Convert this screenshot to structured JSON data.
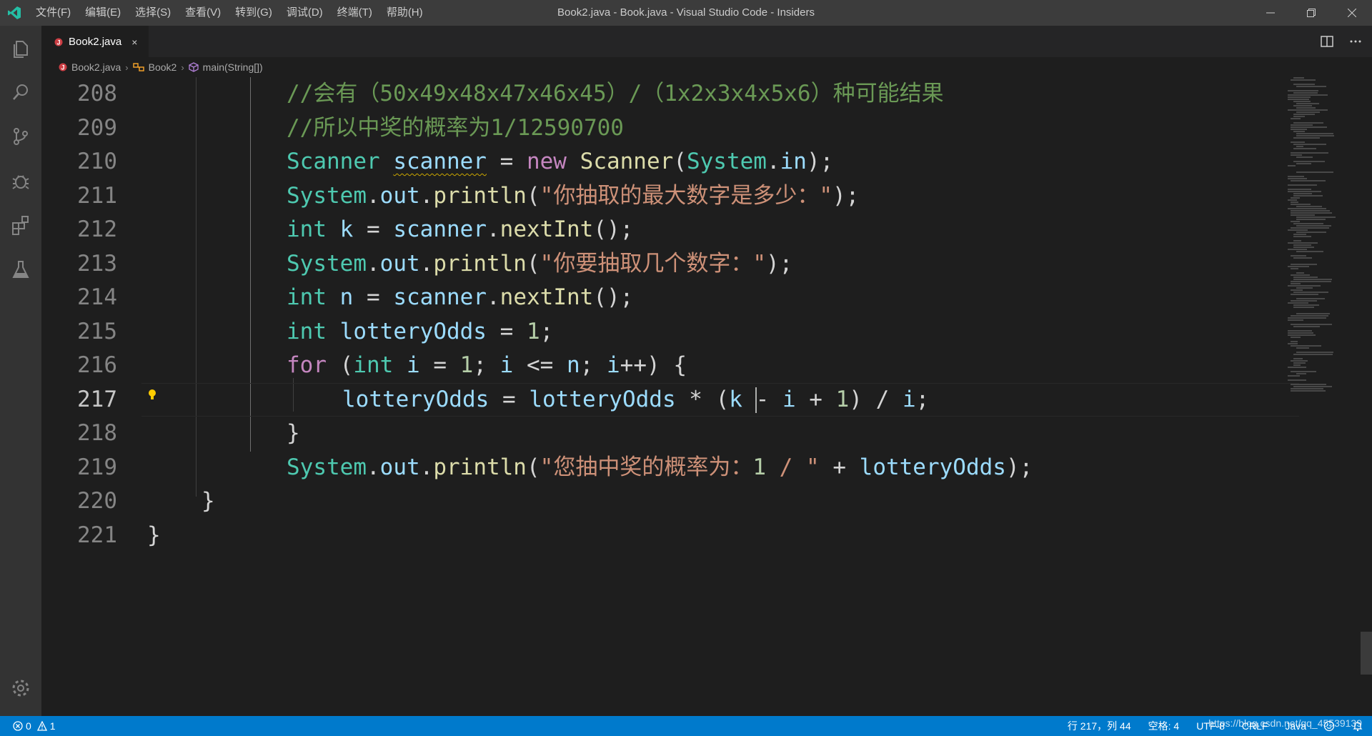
{
  "window": {
    "title": "Book2.java - Book.java - Visual Studio Code - Insiders",
    "menu": [
      "文件(F)",
      "编辑(E)",
      "选择(S)",
      "查看(V)",
      "转到(G)",
      "调试(D)",
      "终端(T)",
      "帮助(H)"
    ]
  },
  "activity_bar": [
    "explorer-icon",
    "search-icon",
    "source-control-icon",
    "debug-icon",
    "extensions-icon",
    "testing-icon",
    "settings-gear-icon"
  ],
  "tab": {
    "label": "Book2.java",
    "close": "×"
  },
  "breadcrumb": {
    "file": "Book2.java",
    "class": "Book2",
    "method": "main(String[])"
  },
  "editor": {
    "active_line": "217",
    "lines": [
      {
        "n": "208",
        "code": "//会有（50x49x48x47x46x45）/（1x2x3x4x5x6）种可能结果"
      },
      {
        "n": "209",
        "code": "//所以中奖的概率为1/12590700"
      },
      {
        "n": "210",
        "code": "Scanner scanner = new Scanner(System.in);"
      },
      {
        "n": "211",
        "code": "System.out.println(\"你抽取的最大数字是多少：\");"
      },
      {
        "n": "212",
        "code": "int k = scanner.nextInt();"
      },
      {
        "n": "213",
        "code": "System.out.println(\"你要抽取几个数字：\");"
      },
      {
        "n": "214",
        "code": "int n = scanner.nextInt();"
      },
      {
        "n": "215",
        "code": "int lotteryOdds = 1;"
      },
      {
        "n": "216",
        "code": "for (int i = 1; i <= n; i++) {"
      },
      {
        "n": "217",
        "code": "lotteryOdds = lotteryOdds * (k - i + 1) / i;"
      },
      {
        "n": "218",
        "code": "}"
      },
      {
        "n": "219",
        "code": "System.out.println(\"您抽中奖的概率为：1 / \" + lotteryOdds);"
      },
      {
        "n": "220",
        "code": "}"
      },
      {
        "n": "221",
        "code": "}"
      }
    ]
  },
  "status": {
    "errors": "0",
    "warnings": "1",
    "position": "行 217，列 44",
    "spaces": "空格: 4",
    "encoding": "UTF-8",
    "eol": "CRLF",
    "language": "Java",
    "watermark": "https://blog.csdn.net/qq_45539139"
  },
  "colors": {
    "statusbar": "#007acc",
    "titlebar": "#3c3c3c",
    "editor_bg": "#1e1e1e",
    "activitybar": "#333333"
  }
}
